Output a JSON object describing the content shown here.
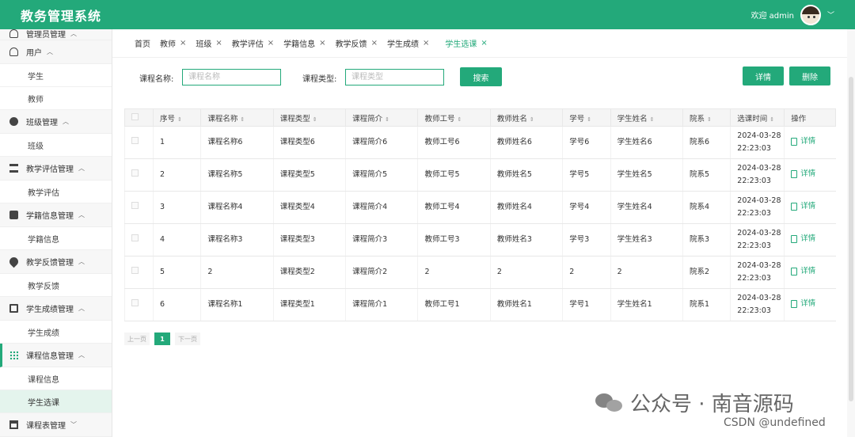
{
  "app": {
    "title": "教务管理系统",
    "welcome": "欢迎 admin"
  },
  "sidebar": {
    "entries": [
      {
        "type": "group",
        "label": "管理员管理",
        "icon": "user-icon"
      },
      {
        "type": "group",
        "label": "用户",
        "icon": "user-icon"
      },
      {
        "type": "item",
        "label": "学生"
      },
      {
        "type": "item",
        "label": "教师"
      },
      {
        "type": "group",
        "label": "班级管理",
        "icon": "dots-icon"
      },
      {
        "type": "item",
        "label": "班级"
      },
      {
        "type": "group",
        "label": "教学评估管理",
        "icon": "list-icon"
      },
      {
        "type": "item",
        "label": "教学评估"
      },
      {
        "type": "group",
        "label": "学籍信息管理",
        "icon": "mail-icon"
      },
      {
        "type": "item",
        "label": "学籍信息"
      },
      {
        "type": "group",
        "label": "教学反馈管理",
        "icon": "drop-icon"
      },
      {
        "type": "item",
        "label": "教学反馈"
      },
      {
        "type": "group",
        "label": "学生成绩管理",
        "icon": "card-icon"
      },
      {
        "type": "item",
        "label": "学生成绩"
      },
      {
        "type": "group",
        "label": "课程信息管理",
        "icon": "grid-icon",
        "active": true
      },
      {
        "type": "item",
        "label": "课程信息"
      },
      {
        "type": "item",
        "label": "学生选课",
        "active": true
      },
      {
        "type": "group",
        "label": "课程表管理",
        "icon": "calendar-icon"
      }
    ]
  },
  "tabs": [
    {
      "label": "首页",
      "closable": false
    },
    {
      "label": "教师",
      "closable": true
    },
    {
      "label": "班级",
      "closable": true
    },
    {
      "label": "教学评估",
      "closable": true
    },
    {
      "label": "学籍信息",
      "closable": true
    },
    {
      "label": "教学反馈",
      "closable": true
    },
    {
      "label": "学生成绩",
      "closable": true
    },
    {
      "label": "学生选课",
      "closable": true,
      "active": true
    }
  ],
  "search": {
    "course_name_label": "课程名称:",
    "course_name_placeholder": "课程名称",
    "course_type_label": "课程类型:",
    "course_type_placeholder": "课程类型",
    "search_btn": "搜索",
    "detail_btn": "详情",
    "delete_btn": "删除"
  },
  "table": {
    "headers": [
      "序号",
      "课程名称",
      "课程类型",
      "课程简介",
      "教师工号",
      "教师姓名",
      "学号",
      "学生姓名",
      "院系",
      "选课时间",
      "操作"
    ],
    "rows": [
      [
        "1",
        "课程名称6",
        "课程类型6",
        "课程简介6",
        "教师工号6",
        "教师姓名6",
        "学号6",
        "学生姓名6",
        "院系6",
        "2024-03-28 22:23:03"
      ],
      [
        "2",
        "课程名称5",
        "课程类型5",
        "课程简介5",
        "教师工号5",
        "教师姓名5",
        "学号5",
        "学生姓名5",
        "院系5",
        "2024-03-28 22:23:03"
      ],
      [
        "3",
        "课程名称4",
        "课程类型4",
        "课程简介4",
        "教师工号4",
        "教师姓名4",
        "学号4",
        "学生姓名4",
        "院系4",
        "2024-03-28 22:23:03"
      ],
      [
        "4",
        "课程名称3",
        "课程类型3",
        "课程简介3",
        "教师工号3",
        "教师姓名3",
        "学号3",
        "学生姓名3",
        "院系3",
        "2024-03-28 22:23:03"
      ],
      [
        "5",
        "2",
        "课程类型2",
        "课程简介2",
        "2",
        "2",
        "2",
        "2",
        "院系2",
        "2024-03-28 22:23:03"
      ],
      [
        "6",
        "课程名称1",
        "课程类型1",
        "课程简介1",
        "教师工号1",
        "教师姓名1",
        "学号1",
        "学生姓名1",
        "院系1",
        "2024-03-28 22:23:03"
      ]
    ],
    "action_label": "详情"
  },
  "pager": {
    "prev": "上一页",
    "current": "1",
    "next": "下一页"
  },
  "watermark": {
    "text": "公众号 · 南音源码",
    "csdn": "CSDN @undefined"
  },
  "colors": {
    "accent": "#23a97a"
  }
}
